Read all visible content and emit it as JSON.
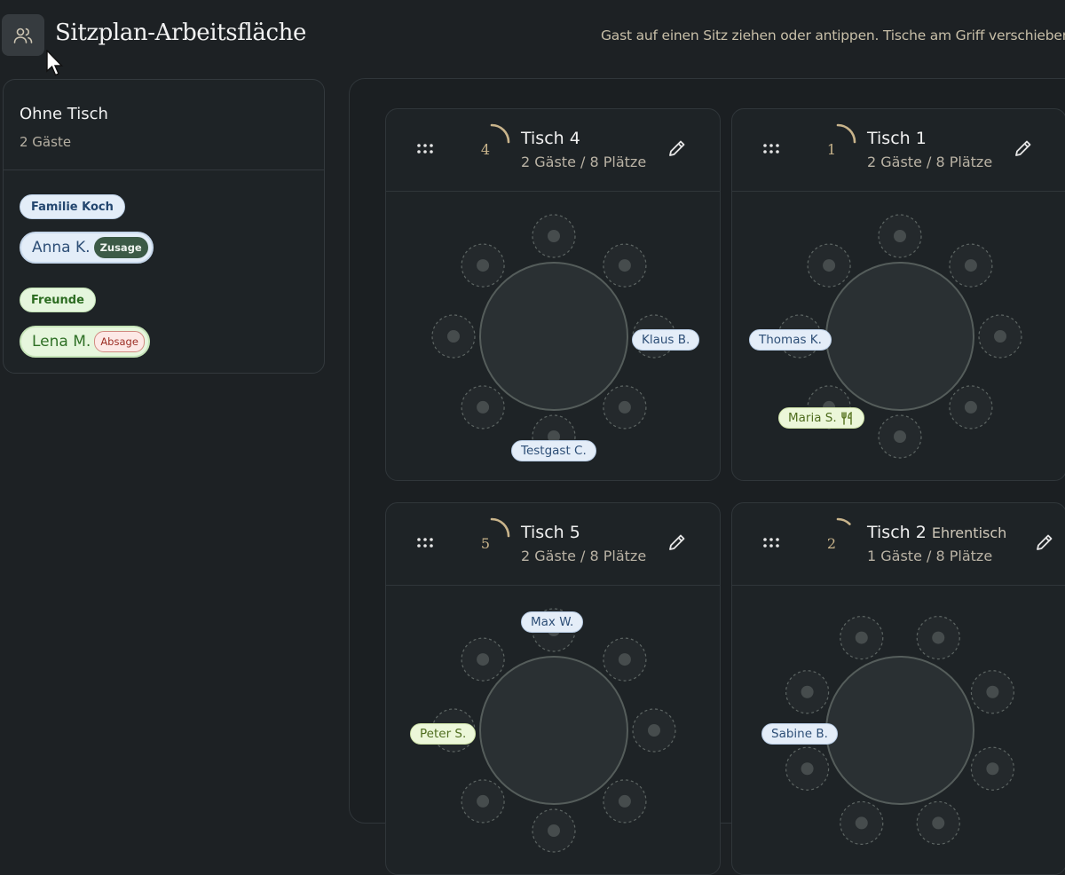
{
  "header": {
    "title": "Sitzplan-Arbeitsfläche",
    "instruction": "Gast auf einen Sitz ziehen oder antippen. Tische am Griff verschieben."
  },
  "sidebar": {
    "title": "Ohne Tisch",
    "subtitle": "2 Gäste",
    "groups": [
      {
        "name": "Familie Koch",
        "color": "blue",
        "guests": [
          {
            "name": "Anna K.",
            "status": "Zusage"
          }
        ]
      },
      {
        "name": "Freunde",
        "color": "green",
        "guests": [
          {
            "name": "Lena M.",
            "status": "Absage"
          }
        ]
      }
    ]
  },
  "tables": [
    {
      "id": "t4",
      "number": "4",
      "name": "Tisch 4",
      "tag": "",
      "stats": "2 Gäste / 8 Plätze",
      "fill": 0.25,
      "guests": [
        {
          "name": "Klaus B.",
          "color": "blue"
        },
        {
          "name": "Testgast C.",
          "color": "blue"
        }
      ]
    },
    {
      "id": "t1",
      "number": "1",
      "name": "Tisch 1",
      "tag": "",
      "stats": "2 Gäste / 8 Plätze",
      "fill": 0.25,
      "guests": [
        {
          "name": "Thomas K.",
          "color": "blue"
        },
        {
          "name": "Maria S.",
          "color": "green",
          "icon": "fork-knife-icon"
        }
      ]
    },
    {
      "id": "t5",
      "number": "5",
      "name": "Tisch 5",
      "tag": "",
      "stats": "2 Gäste / 8 Plätze",
      "fill": 0.25,
      "guests": [
        {
          "name": "Max W.",
          "color": "blue"
        },
        {
          "name": "Peter S.",
          "color": "green"
        }
      ]
    },
    {
      "id": "t2",
      "number": "2",
      "name": "Tisch 2",
      "tag": "Ehrentisch",
      "stats": "1 Gäste / 8 Plätze",
      "fill": 0.125,
      "guests": [
        {
          "name": "Sabine B.",
          "color": "blue"
        }
      ]
    }
  ],
  "colors": {
    "background": "#1d2124",
    "accent_gold": "#c9b48b",
    "pill_blue": "#e4edf8",
    "pill_green": "#e6f6dd",
    "badge_zusage": "#3c5a46",
    "badge_absage_text": "#9c2e24"
  }
}
